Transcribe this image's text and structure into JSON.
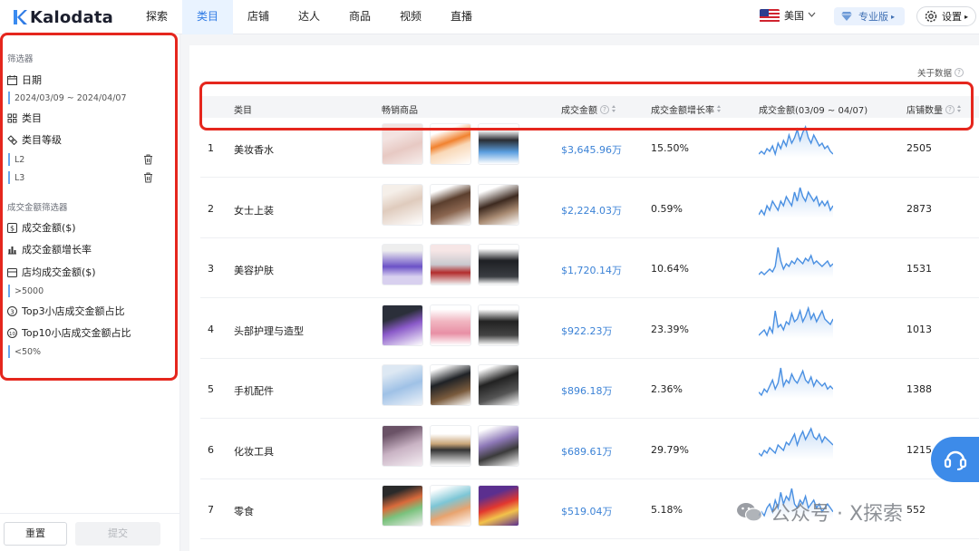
{
  "brand": {
    "name": "Kalodata"
  },
  "nav": {
    "items": [
      "探索",
      "类目",
      "店铺",
      "达人",
      "商品",
      "视频",
      "直播"
    ],
    "active_index": 1
  },
  "header": {
    "country": "美国",
    "pro_label": "专业版",
    "settings_label": "设置"
  },
  "sidebar": {
    "filter_title": "筛选器",
    "date_label": "日期",
    "date_value": "2024/03/09 ~ 2024/04/07",
    "category_label": "类目",
    "category_level_label": "类目等级",
    "levels": [
      "L2",
      "L3"
    ],
    "gmv_filter_title": "成交金额筛选器",
    "gmv_label": "成交金额($)",
    "gmv_growth_label": "成交金额增长率",
    "avg_shop_gmv_label": "店均成交金额($)",
    "avg_shop_gmv_value": ">5000",
    "top3_label": "Top3小店成交金额占比",
    "top10_label": "Top10小店成交金额占比",
    "top10_value": "<50%",
    "reset_label": "重置",
    "submit_label": "提交"
  },
  "main": {
    "about_label": "关于数据"
  },
  "table": {
    "columns": {
      "category": "类目",
      "products": "畅销商品",
      "gmv": "成交金额",
      "growth": "成交金额增长率",
      "gmv_trend": "成交金额(03/09 ~ 04/07)",
      "shops": "店铺数量"
    },
    "rows": [
      {
        "rank": "1",
        "category": "美妆香水",
        "gmv": "$3,645.96万",
        "growth": "15.50%",
        "shops": "2505",
        "trend": [
          5,
          6,
          5,
          7,
          6,
          8,
          5,
          9,
          7,
          10,
          8,
          12,
          9,
          11,
          14,
          10,
          13,
          15,
          11,
          9,
          12,
          10,
          8,
          9,
          7,
          8,
          6,
          5
        ]
      },
      {
        "rank": "2",
        "category": "女士上装",
        "gmv": "$2,224.03万",
        "growth": "0.59%",
        "shops": "2873",
        "trend": [
          6,
          7,
          6,
          8,
          7,
          9,
          8,
          7,
          9,
          8,
          10,
          9,
          8,
          11,
          9,
          12,
          10,
          9,
          11,
          10,
          9,
          10,
          8,
          9,
          8,
          9,
          7,
          8
        ]
      },
      {
        "rank": "3",
        "category": "美容护肤",
        "gmv": "$1,720.14万",
        "growth": "10.64%",
        "shops": "1531",
        "trend": [
          4,
          5,
          4,
          5,
          6,
          5,
          7,
          14,
          9,
          6,
          8,
          7,
          9,
          8,
          10,
          9,
          8,
          10,
          9,
          11,
          8,
          9,
          8,
          7,
          8,
          9,
          7,
          8
        ]
      },
      {
        "rank": "4",
        "category": "头部护理与造型",
        "gmv": "$922.23万",
        "growth": "23.39%",
        "shops": "1013",
        "trend": [
          4,
          5,
          6,
          4,
          7,
          5,
          13,
          7,
          8,
          6,
          9,
          8,
          12,
          9,
          10,
          13,
          9,
          11,
          14,
          10,
          12,
          9,
          11,
          13,
          10,
          9,
          8,
          10
        ]
      },
      {
        "rank": "5",
        "category": "手机配件",
        "gmv": "$896.18万",
        "growth": "2.36%",
        "shops": "1388",
        "trend": [
          6,
          5,
          7,
          6,
          8,
          10,
          7,
          9,
          14,
          8,
          10,
          9,
          12,
          10,
          9,
          11,
          13,
          10,
          9,
          11,
          8,
          10,
          9,
          8,
          9,
          7,
          8,
          7
        ]
      },
      {
        "rank": "6",
        "category": "化妆工具",
        "gmv": "$689.61万",
        "growth": "29.79%",
        "shops": "1215",
        "trend": [
          5,
          4,
          6,
          5,
          7,
          6,
          5,
          8,
          7,
          6,
          9,
          8,
          10,
          12,
          8,
          11,
          13,
          10,
          12,
          14,
          11,
          10,
          12,
          9,
          11,
          10,
          9,
          8
        ]
      },
      {
        "rank": "7",
        "category": "零食",
        "gmv": "$519.04万",
        "growth": "5.18%",
        "shops": "552",
        "trend": [
          6,
          7,
          6,
          8,
          9,
          7,
          10,
          8,
          12,
          9,
          11,
          10,
          13,
          9,
          8,
          10,
          9,
          11,
          8,
          9,
          10,
          8,
          9,
          7,
          8,
          9,
          8,
          7
        ]
      }
    ]
  },
  "watermark": {
    "text": "公众号 · X探索"
  },
  "colors": {
    "accent": "#2f7be5",
    "highlight": "#e5261d",
    "gmv_text": "#3b82d6"
  }
}
